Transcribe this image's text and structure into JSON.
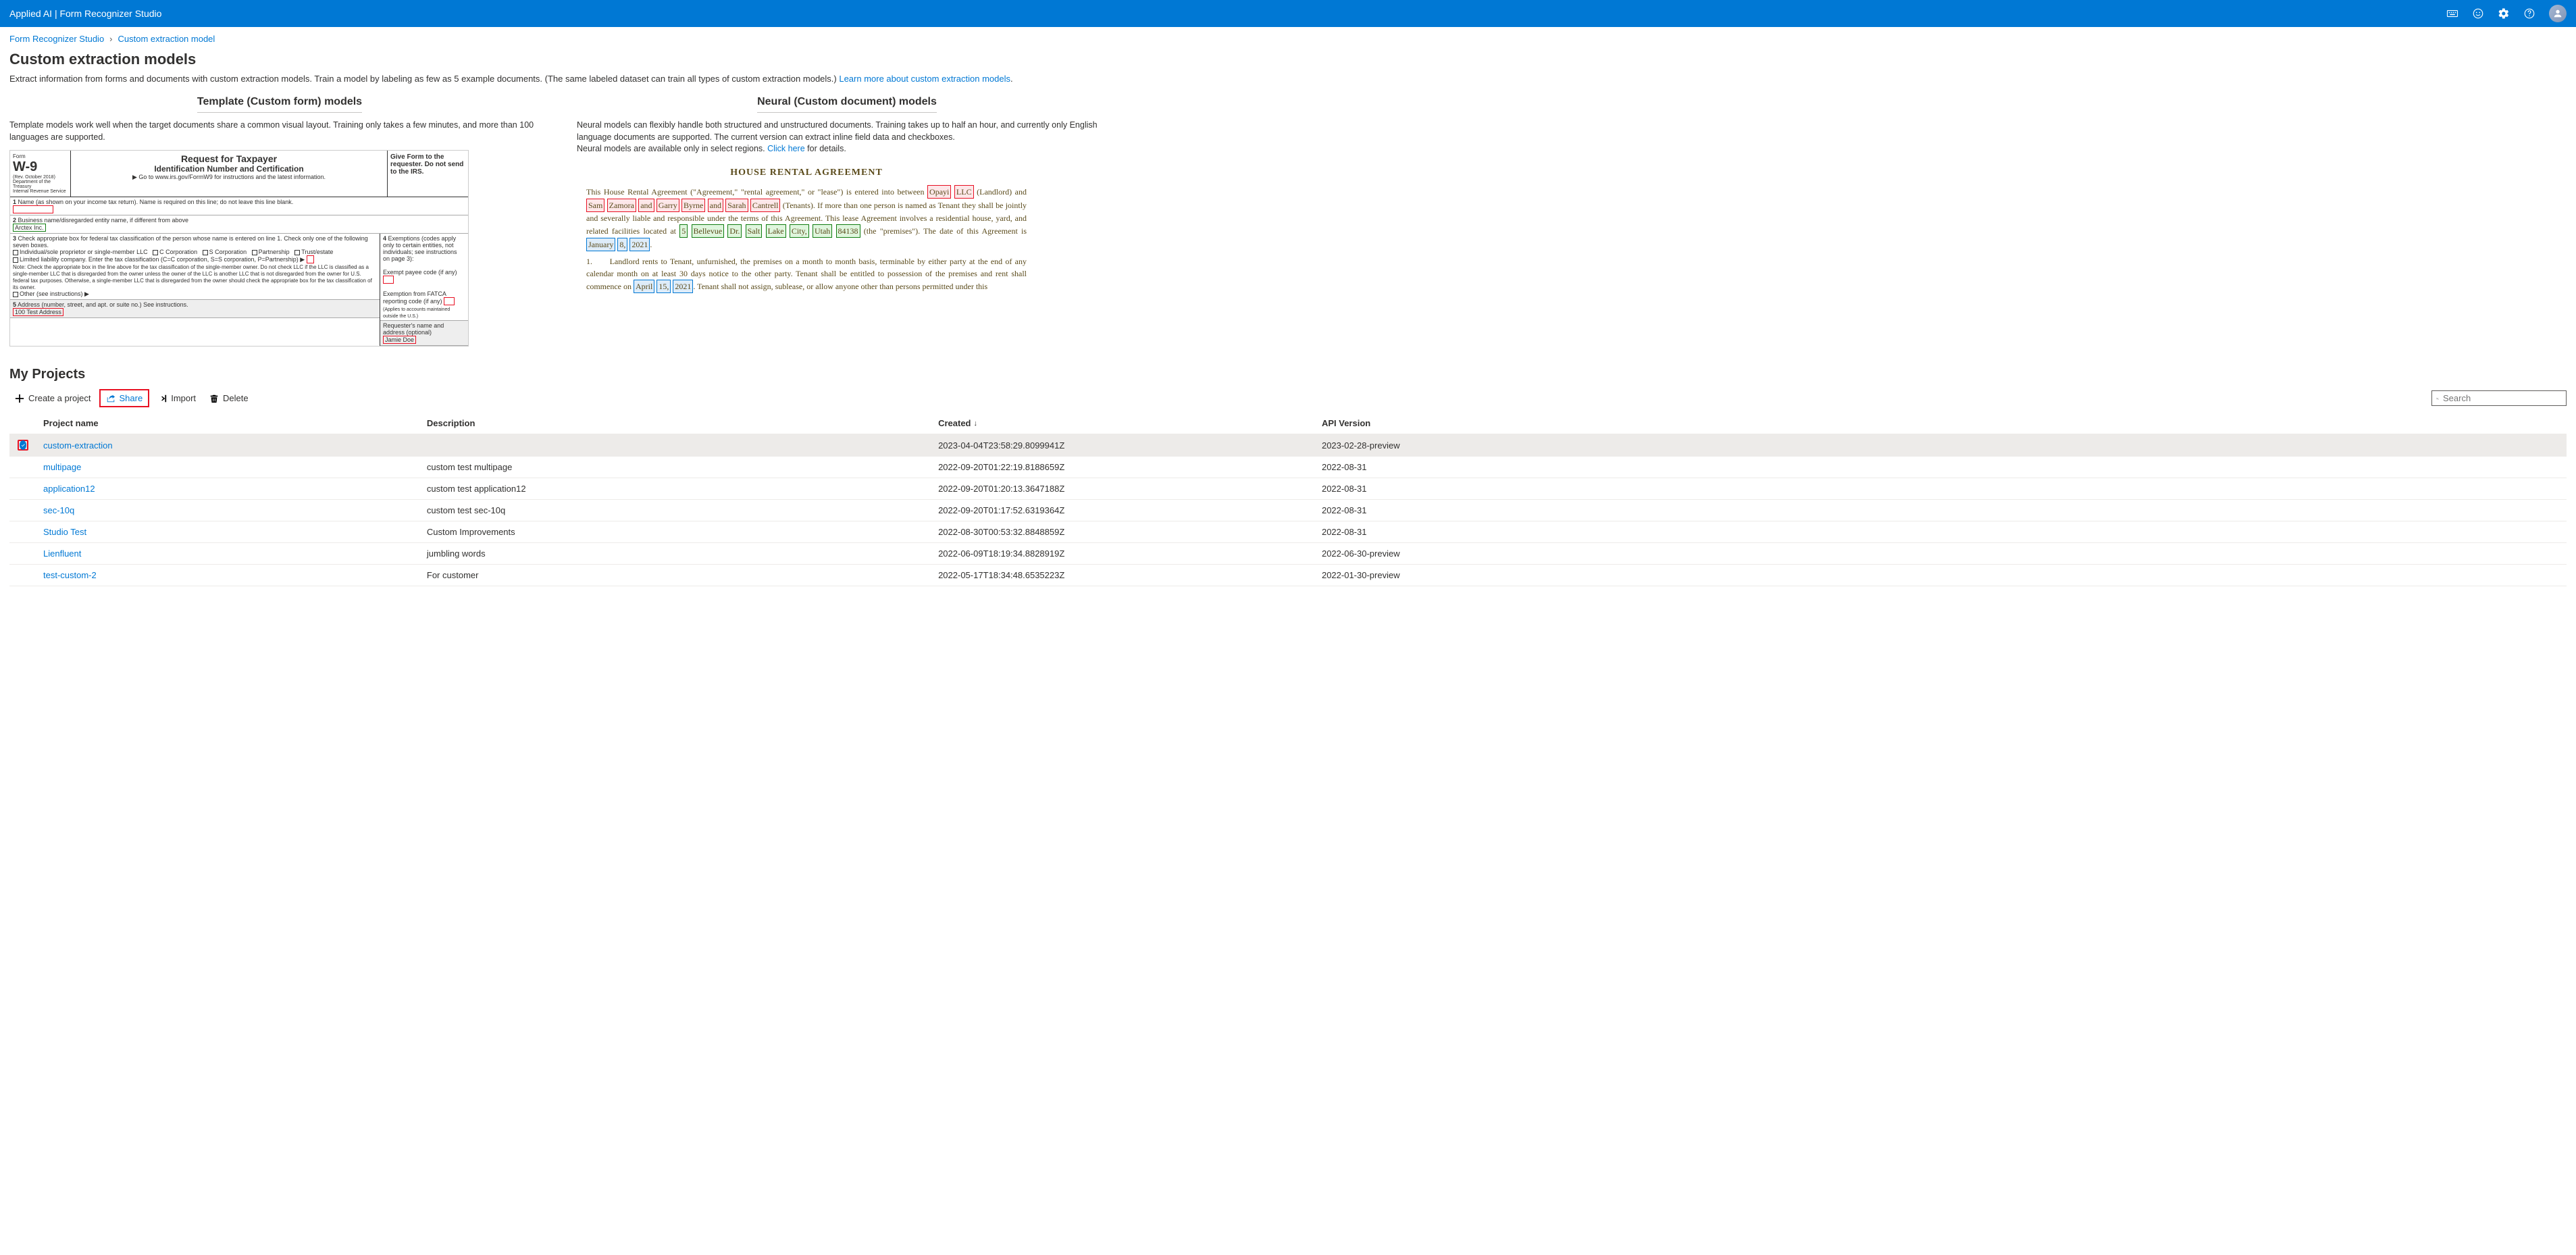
{
  "header": {
    "title": "Applied AI | Form Recognizer Studio"
  },
  "breadcrumb": {
    "root": "Form Recognizer Studio",
    "current": "Custom extraction model"
  },
  "page": {
    "title": "Custom extraction models",
    "desc": "Extract information from forms and documents with custom extraction models. Train a model by labeling as few as 5 example documents. (The same labeled dataset can train all types of custom extraction models.) ",
    "learn_more": "Learn more about custom extraction models"
  },
  "template_model": {
    "title": "Template (Custom form) models",
    "desc": "Template models work well when the target documents share a common visual layout. Training only takes a few minutes, and more than 100 languages are supported."
  },
  "neural_model": {
    "title": "Neural (Custom document) models",
    "desc_a": "Neural models can flexibly handle both structured and unstructured documents. Training takes up to half an hour, and currently only English language documents are supported. The current version can extract inline field data and checkboxes.",
    "desc_b": "Neural models are available only in select regions. ",
    "click_here": "Click here",
    "desc_c": " for details."
  },
  "projects": {
    "heading": "My Projects",
    "actions": {
      "create": "Create a project",
      "share": "Share",
      "import": "Import",
      "delete": "Delete"
    },
    "search_placeholder": "Search",
    "columns": {
      "name": "Project name",
      "desc": "Description",
      "created": "Created",
      "api": "API Version"
    },
    "rows": [
      {
        "name": "custom-extraction",
        "desc": "",
        "created": "2023-04-04T23:58:29.8099941Z",
        "api": "2023-02-28-preview",
        "selected": true
      },
      {
        "name": "multipage",
        "desc": "custom test multipage",
        "created": "2022-09-20T01:22:19.8188659Z",
        "api": "2022-08-31"
      },
      {
        "name": "application12",
        "desc": "custom test application12",
        "created": "2022-09-20T01:20:13.3647188Z",
        "api": "2022-08-31"
      },
      {
        "name": "sec-10q",
        "desc": "custom test sec-10q",
        "created": "2022-09-20T01:17:52.6319364Z",
        "api": "2022-08-31"
      },
      {
        "name": "Studio Test",
        "desc": "Custom Improvements",
        "created": "2022-08-30T00:53:32.8848859Z",
        "api": "2022-08-31"
      },
      {
        "name": "Lienfluent",
        "desc": "jumbling words",
        "created": "2022-06-09T18:19:34.8828919Z",
        "api": "2022-06-30-preview"
      },
      {
        "name": "test-custom-2",
        "desc": "For customer",
        "created": "2022-05-17T18:34:48.6535223Z",
        "api": "2022-01-30-preview"
      }
    ]
  }
}
